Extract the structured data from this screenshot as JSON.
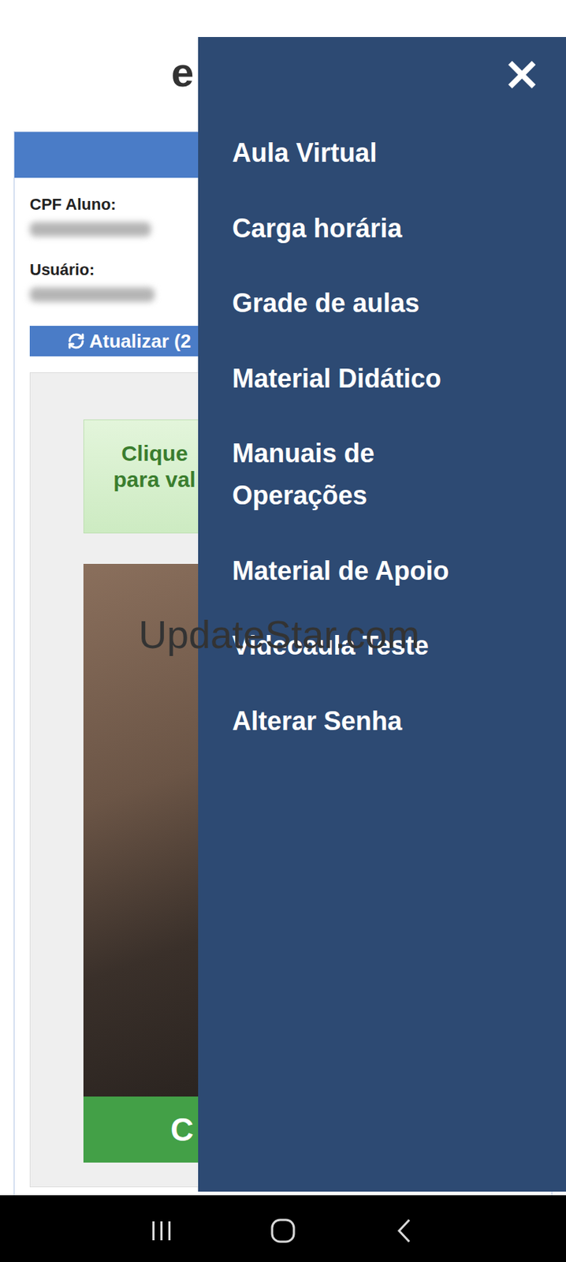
{
  "header": {
    "logo": "e"
  },
  "card": {
    "fields": [
      {
        "label": "CPF Aluno:"
      },
      {
        "label": "Usuário:"
      }
    ],
    "refresh_button": "Atualizar (2",
    "validation_notice": [
      "Clique",
      "para val"
    ],
    "confirm_button": "C"
  },
  "menu": {
    "close": "×",
    "items": [
      "Aula Virtual",
      "Carga horária",
      "Grade de aulas",
      "Material Didático",
      "Manuais de Operações",
      "Material de Apoio",
      "Videoaula Teste",
      "Alterar Senha"
    ]
  },
  "watermark": "UpdateStar.com"
}
